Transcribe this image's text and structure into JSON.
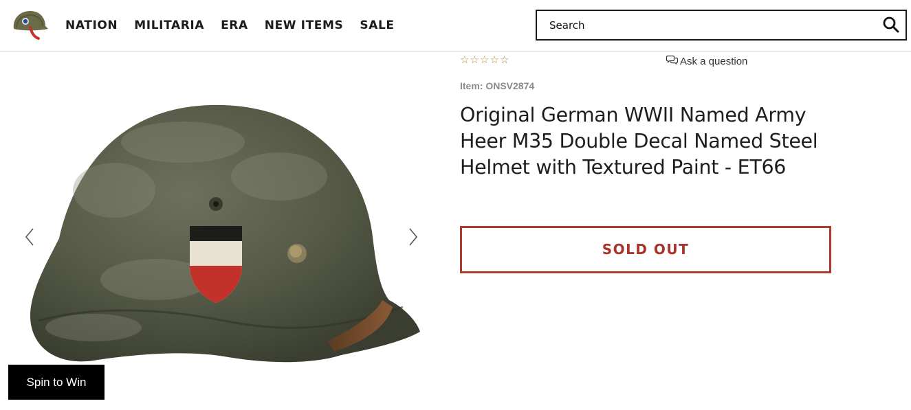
{
  "header": {
    "nav": [
      "NATION",
      "MILITARIA",
      "ERA",
      "NEW ITEMS",
      "SALE"
    ],
    "search": {
      "placeholder": "Search",
      "value": ""
    }
  },
  "product": {
    "rating_stars": 5,
    "rating_filled": 0,
    "ask_label": "Ask a question",
    "item_code": "Item: ONSV2874",
    "title": "Original German WWII Named Army Heer M35 Double Decal Named Steel Helmet with Textured Paint - ET66",
    "status_button": "SOLD OUT"
  },
  "widget": {
    "spin_label": "Spin to Win"
  },
  "icons": {
    "logo": "helmet-logo-icon",
    "search": "search-icon",
    "prev": "chevron-left-icon",
    "next": "chevron-right-icon",
    "star": "star-outline-icon",
    "ask": "chat-bubbles-icon"
  },
  "colors": {
    "accent_red": "#b03a2e",
    "star_gold": "#b48a3c",
    "helmet_green": "#5a5e4a"
  }
}
